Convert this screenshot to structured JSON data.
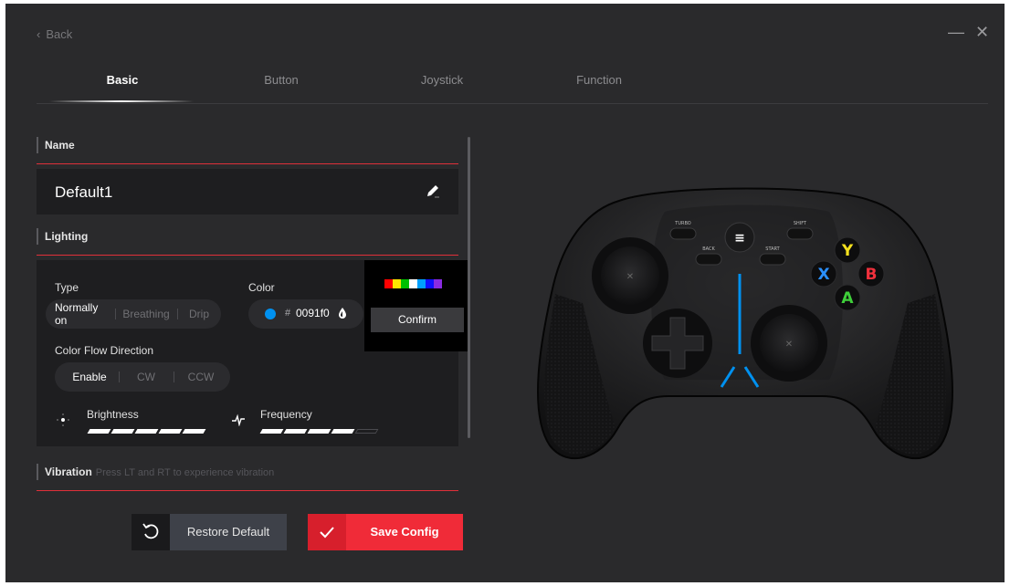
{
  "header": {
    "back_label": "Back",
    "minimize_glyph": "—",
    "close_glyph": "✕"
  },
  "tabs": [
    {
      "label": "Basic",
      "active": true
    },
    {
      "label": "Button",
      "active": false
    },
    {
      "label": "Joystick",
      "active": false
    },
    {
      "label": "Function",
      "active": false
    }
  ],
  "name_section": {
    "title": "Name",
    "value": "Default1"
  },
  "lighting": {
    "title": "Lighting",
    "type_label": "Type",
    "type_options": [
      {
        "label": "Normally on",
        "selected": true
      },
      {
        "label": "Breathing",
        "selected": false
      },
      {
        "label": "Drip",
        "selected": false
      }
    ],
    "color_label": "Color",
    "color_hash": "#",
    "color_value": "0091f0",
    "color_swatch": "#0091f0",
    "picker_swatches": [
      "#ff0000",
      "#ffe600",
      "#00c000",
      "#ffffff",
      "#00a0ff",
      "#1010ff",
      "#8a2be2"
    ],
    "confirm_label": "Confirm",
    "flow_label": "Color Flow Direction",
    "flow_options": [
      {
        "label": "Enable",
        "selected": true
      },
      {
        "label": "CW",
        "selected": false
      },
      {
        "label": "CCW",
        "selected": false
      }
    ],
    "brightness_label": "Brightness",
    "brightness_level": 5,
    "brightness_max": 5,
    "frequency_label": "Frequency",
    "frequency_level": 4,
    "frequency_max": 5
  },
  "vibration": {
    "title": "Vibration",
    "hint": "Press LT and RT to experience vibration"
  },
  "actions": {
    "restore_label": "Restore Default",
    "save_label": "Save Config"
  },
  "controller": {
    "labels": {
      "turbo": "TURBO",
      "shift": "SHIFT",
      "back": "BACK",
      "start": "START"
    },
    "face_buttons": [
      {
        "letter": "Y",
        "color": "#f4e01e"
      },
      {
        "letter": "X",
        "color": "#2a90ff"
      },
      {
        "letter": "B",
        "color": "#f0303c"
      },
      {
        "letter": "A",
        "color": "#3fcf3a"
      }
    ],
    "light_color": "#0091f0"
  },
  "colors": {
    "accent_red": "#f02b38",
    "background": "#2a2a2c"
  }
}
